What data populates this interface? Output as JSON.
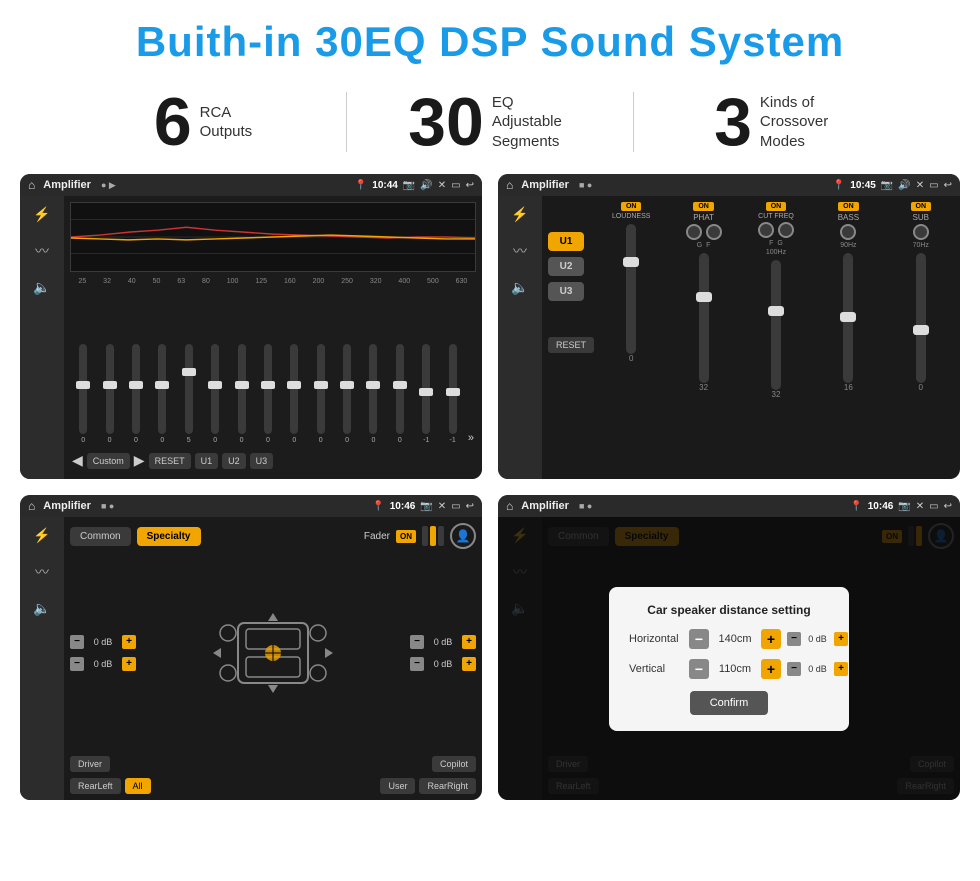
{
  "header": {
    "title": "Buith-in 30EQ DSP Sound System"
  },
  "stats": [
    {
      "number": "6",
      "label": "RCA\nOutputs"
    },
    {
      "number": "30",
      "label": "EQ Adjustable\nSegments"
    },
    {
      "number": "3",
      "label": "Kinds of\nCrossover Modes"
    }
  ],
  "screens": [
    {
      "id": "eq-screen",
      "status_bar": {
        "title": "Amplifier",
        "time": "10:44"
      }
    },
    {
      "id": "mixer-screen",
      "status_bar": {
        "title": "Amplifier",
        "time": "10:45"
      },
      "channels": [
        {
          "label": "LOUDNESS",
          "on": true
        },
        {
          "label": "PHAT",
          "on": true
        },
        {
          "label": "CUT FREQ",
          "on": true
        },
        {
          "label": "BASS",
          "on": true
        },
        {
          "label": "SUB",
          "on": true
        }
      ]
    },
    {
      "id": "crossover-screen",
      "status_bar": {
        "title": "Amplifier",
        "time": "10:46"
      },
      "tabs": [
        "Common",
        "Specialty"
      ],
      "fader_label": "Fader",
      "fader_on": true,
      "positions": [
        "Driver",
        "RearLeft",
        "All",
        "User",
        "RearRight",
        "Copilot"
      ]
    },
    {
      "id": "dialog-screen",
      "status_bar": {
        "title": "Amplifier",
        "time": "10:46"
      },
      "dialog": {
        "title": "Car speaker distance setting",
        "horizontal_label": "Horizontal",
        "horizontal_value": "140cm",
        "vertical_label": "Vertical",
        "vertical_value": "110cm",
        "confirm_label": "Confirm"
      }
    }
  ],
  "eq_freqs": [
    "25",
    "32",
    "40",
    "50",
    "63",
    "80",
    "100",
    "125",
    "160",
    "200",
    "250",
    "320",
    "400",
    "500",
    "630"
  ],
  "eq_values": [
    "0",
    "0",
    "0",
    "0",
    "5",
    "0",
    "0",
    "0",
    "0",
    "0",
    "0",
    "0",
    "0",
    "-1",
    "0",
    "-1"
  ],
  "eq_presets": [
    "Custom",
    "RESET",
    "U1",
    "U2",
    "U3"
  ],
  "mixer_presets": [
    "U1",
    "U2",
    "U3"
  ]
}
